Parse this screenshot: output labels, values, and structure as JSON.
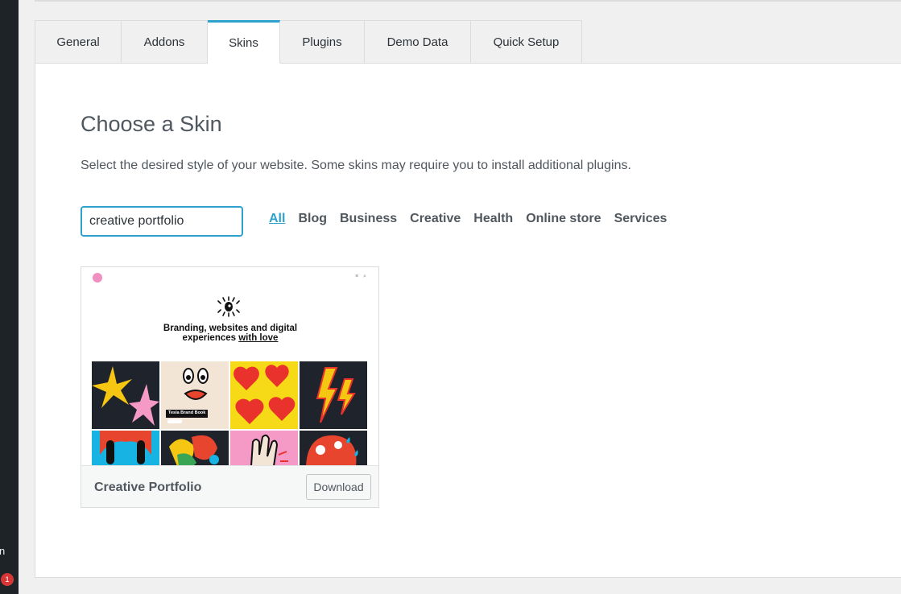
{
  "tabs": [
    {
      "label": "General"
    },
    {
      "label": "Addons"
    },
    {
      "label": "Skins",
      "active": true
    },
    {
      "label": "Plugins"
    },
    {
      "label": "Demo Data"
    },
    {
      "label": "Quick Setup"
    }
  ],
  "main": {
    "title": "Choose a Skin",
    "description": "Select the desired style of your website. Some skins may require you to install additional plugins.",
    "search": {
      "value": "creative portfolio"
    },
    "filters": [
      {
        "label": "All",
        "active": true
      },
      {
        "label": "Blog"
      },
      {
        "label": "Business"
      },
      {
        "label": "Creative"
      },
      {
        "label": "Health"
      },
      {
        "label": "Online store"
      },
      {
        "label": "Services"
      }
    ]
  },
  "skin_card": {
    "name": "Creative Portfolio",
    "download_label": "Download",
    "preview": {
      "headline_line1": "Branding, websites and digital",
      "headline_line2_prefix": "experiences ",
      "headline_line2_link": "with love",
      "tile_label": "Tesla Brand Book"
    }
  },
  "admin_sidebar": {
    "partial_label": "n",
    "badge_count": "1"
  },
  "colors": {
    "accent": "#2ea2cc",
    "sidebar": "#1d2327",
    "badge": "#d63638"
  }
}
